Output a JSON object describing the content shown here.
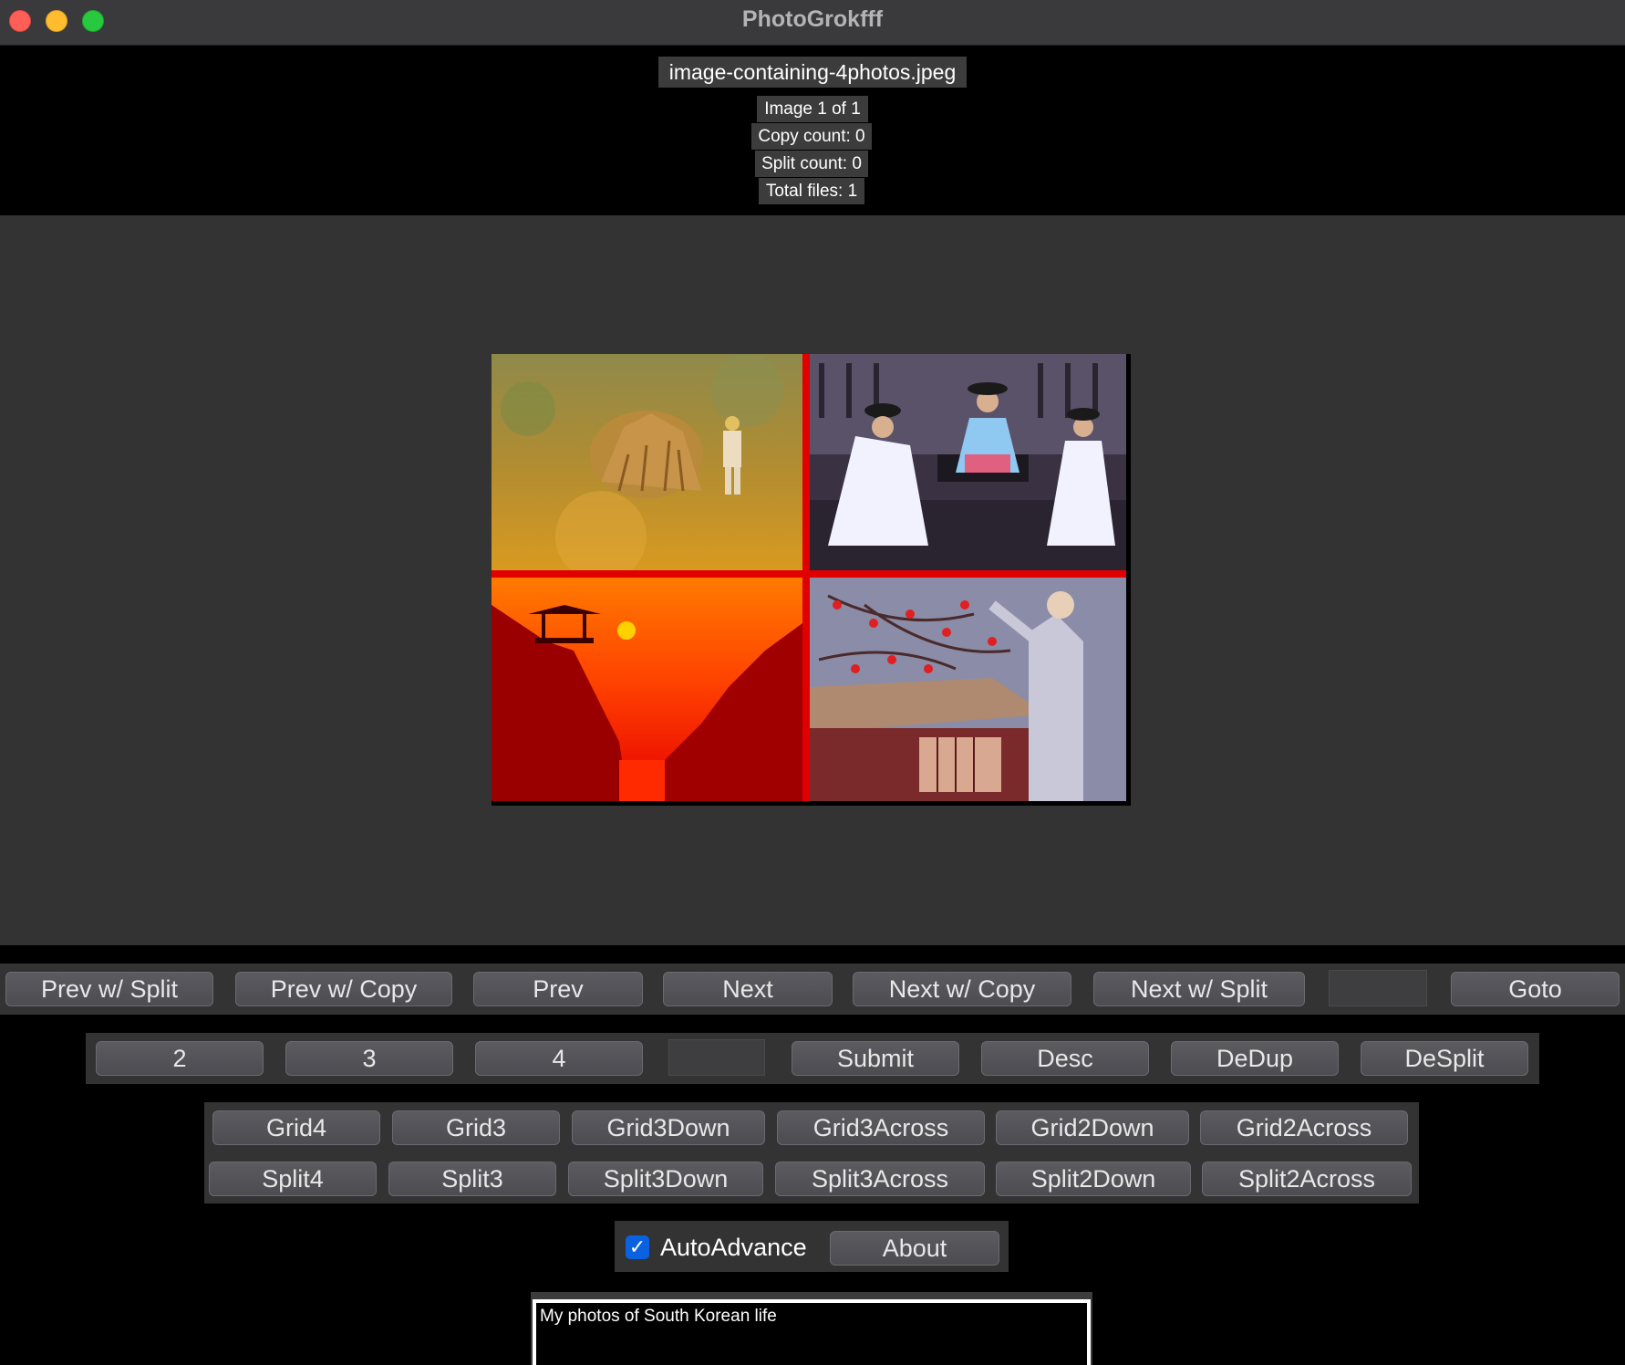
{
  "window": {
    "title": "PhotoGrokfff"
  },
  "header": {
    "filename": "image-containing-4photos.jpeg",
    "image_index": "Image 1 of 1",
    "copy_count": "Copy count: 0",
    "split_count": "Split count: 0",
    "total_files": "Total files: 1"
  },
  "viewer": {
    "grid_line_color": "#e00000",
    "photos": [
      "farmer-with-haystack",
      "kneeling-ceremony",
      "sunset-pavilion-gorge",
      "persimmon-tree-cottage"
    ]
  },
  "nav": {
    "prev_split": "Prev w/ Split",
    "prev_copy": "Prev w/ Copy",
    "prev": "Prev",
    "next": "Next",
    "next_copy": "Next w/ Copy",
    "next_split": "Next w/ Split",
    "goto_value": "",
    "goto": "Goto"
  },
  "split_row": {
    "two": "2",
    "three": "3",
    "four": "4",
    "custom_value": "",
    "submit": "Submit",
    "desc": "Desc",
    "dedup": "DeDup",
    "desplit": "DeSplit"
  },
  "layouts": {
    "grid": [
      "Grid4",
      "Grid3",
      "Grid3Down",
      "Grid3Across",
      "Grid2Down",
      "Grid2Across"
    ],
    "split": [
      "Split4",
      "Split3",
      "Split3Down",
      "Split3Across",
      "Split2Down",
      "Split2Across"
    ]
  },
  "options": {
    "auto_advance": "AutoAdvance",
    "auto_advance_checked": true,
    "about": "About"
  },
  "description": {
    "text": "My photos of South Korean life"
  }
}
